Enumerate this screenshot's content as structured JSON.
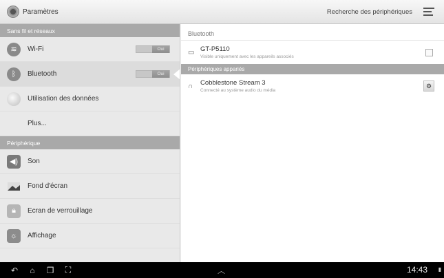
{
  "actionbar": {
    "title": "Paramètres",
    "scan_label": "Recherche des périphériques"
  },
  "left": {
    "section1": "Sans fil et réseaux",
    "wifi_label": "Wi-Fi",
    "wifi_toggle": "Oui",
    "bt_label": "Bluetooth",
    "bt_toggle": "Oui",
    "data_label": "Utilisation des données",
    "more_label": "Plus...",
    "section2": "Périphérique",
    "son_label": "Son",
    "wall_label": "Fond d'écran",
    "lock_label": "Ecran de verrouillage",
    "disp_label": "Affichage"
  },
  "right": {
    "header": "Bluetooth",
    "device_name": "GT-P5110",
    "device_sub": "Visible uniquement avec les appareils associés",
    "paired_header": "Périphériques appariés",
    "paired_name": "Cobblestone Stream 3",
    "paired_sub": "Connecté au système audio du média"
  },
  "navbar": {
    "clock": "14:43"
  },
  "colors": {
    "section_header": "#a9a9a9",
    "navbar": "#000000"
  }
}
